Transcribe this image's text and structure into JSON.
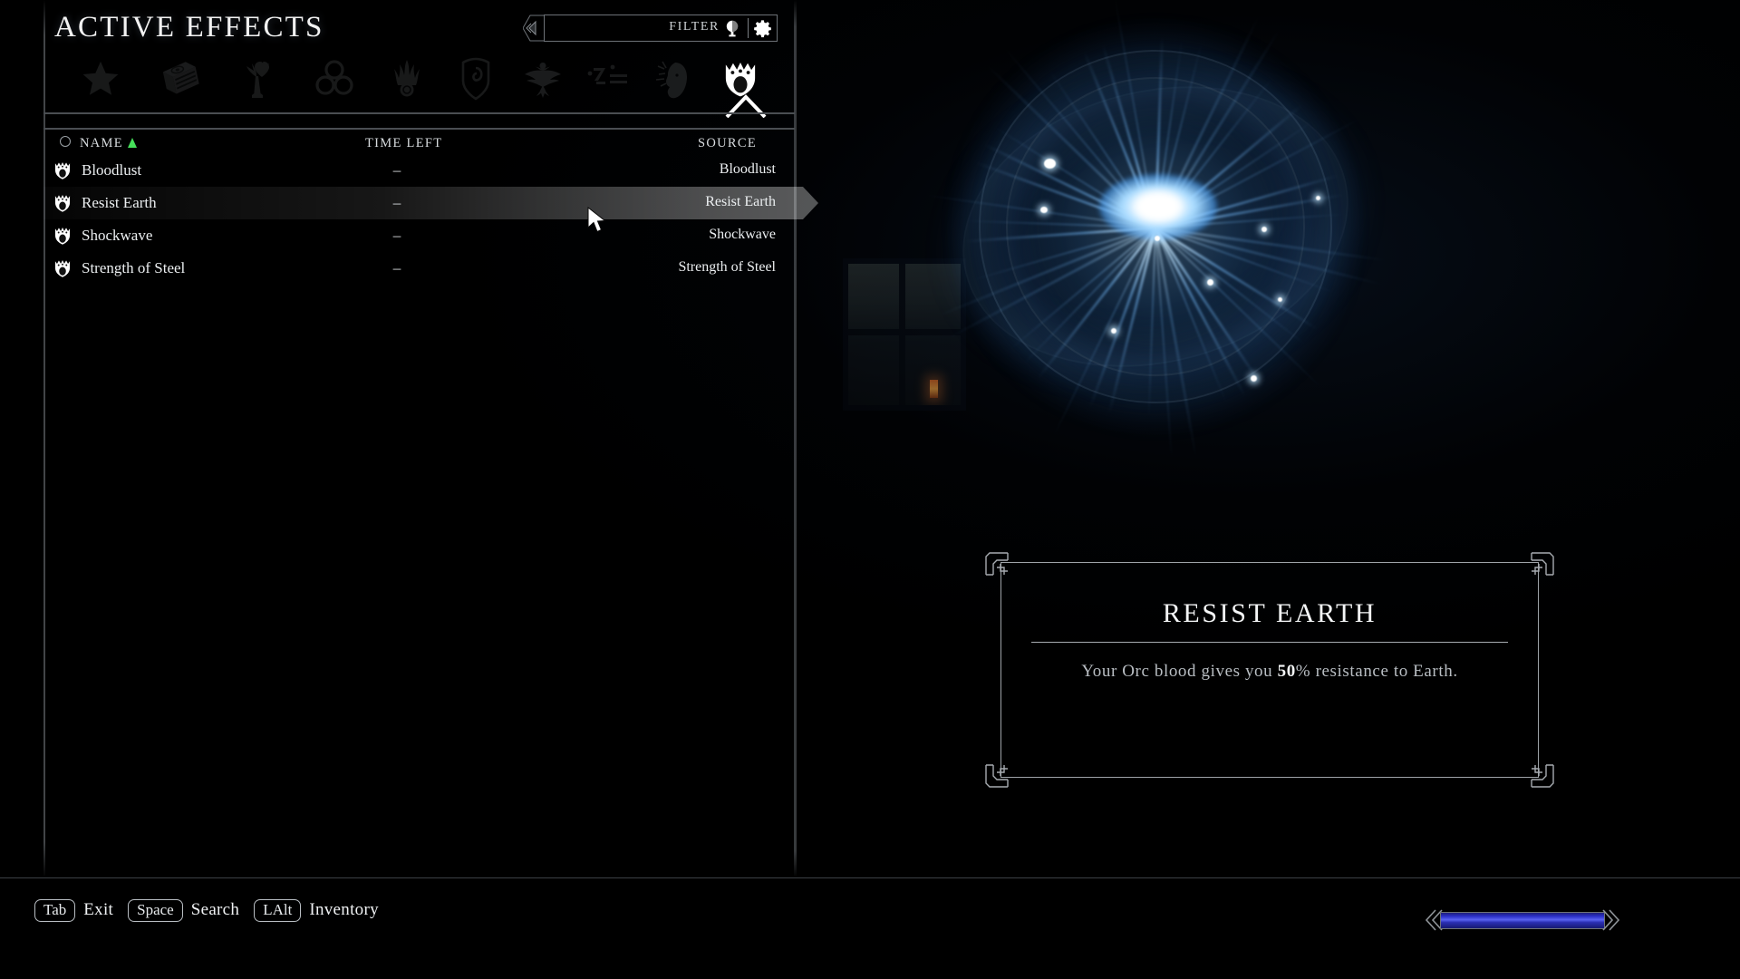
{
  "screen": {
    "title": "ACTIVE EFFECTS"
  },
  "filter": {
    "label": "FILTER",
    "value": "",
    "placeholder": "",
    "orb_icon": "filter-orb-icon",
    "gear_icon": "gear-icon"
  },
  "tabs": [
    {
      "name": "favorites",
      "icon": "star-icon",
      "active": false
    },
    {
      "name": "magic",
      "icon": "spellbook-icon",
      "active": false
    },
    {
      "name": "alchemy",
      "icon": "tree-heart-icon",
      "active": false
    },
    {
      "name": "crafting",
      "icon": "three-rings-icon",
      "active": false
    },
    {
      "name": "destruction",
      "icon": "flame-comet-icon",
      "active": false
    },
    {
      "name": "shield",
      "icon": "shield-eye-icon",
      "active": false
    },
    {
      "name": "shouts",
      "icon": "eagle-icon",
      "active": false
    },
    {
      "name": "dragon-script",
      "icon": "dragon-runes-icon",
      "active": false
    },
    {
      "name": "character",
      "icon": "face-profile-icon",
      "active": false
    },
    {
      "name": "active-effects",
      "icon": "crowned-shield-icon",
      "active": true
    }
  ],
  "columns": {
    "name": "NAME",
    "time_left": "TIME LEFT",
    "source": "SOURCE",
    "sort_column": "NAME",
    "sort_direction": "ascending",
    "sort_color": "#46e05a"
  },
  "effects": [
    {
      "name": "Bloodlust",
      "time_left": "–",
      "source": "Bloodlust",
      "icon": "crowned-shield-icon",
      "selected": false
    },
    {
      "name": "Resist Earth",
      "time_left": "–",
      "source": "Resist Earth",
      "icon": "crowned-shield-icon",
      "selected": true
    },
    {
      "name": "Shockwave",
      "time_left": "–",
      "source": "Shockwave",
      "icon": "crowned-shield-icon",
      "selected": false
    },
    {
      "name": "Strength of Steel",
      "time_left": "–",
      "source": "Strength of Steel",
      "icon": "crowned-shield-icon",
      "selected": false
    }
  ],
  "detail_card": {
    "title": "RESIST EARTH",
    "description_before": "Your Orc blood gives you ",
    "amount": "50",
    "percent": "%",
    "description_after": " resistance to Earth."
  },
  "bottom_hints": [
    {
      "key": "Tab",
      "label": "Exit"
    },
    {
      "key": "Space",
      "label": "Search"
    },
    {
      "key": "LAlt",
      "label": "Inventory"
    }
  ],
  "magicka": {
    "name": "magicka-bar",
    "fill_percent": 100,
    "color": "#3a40e0"
  }
}
